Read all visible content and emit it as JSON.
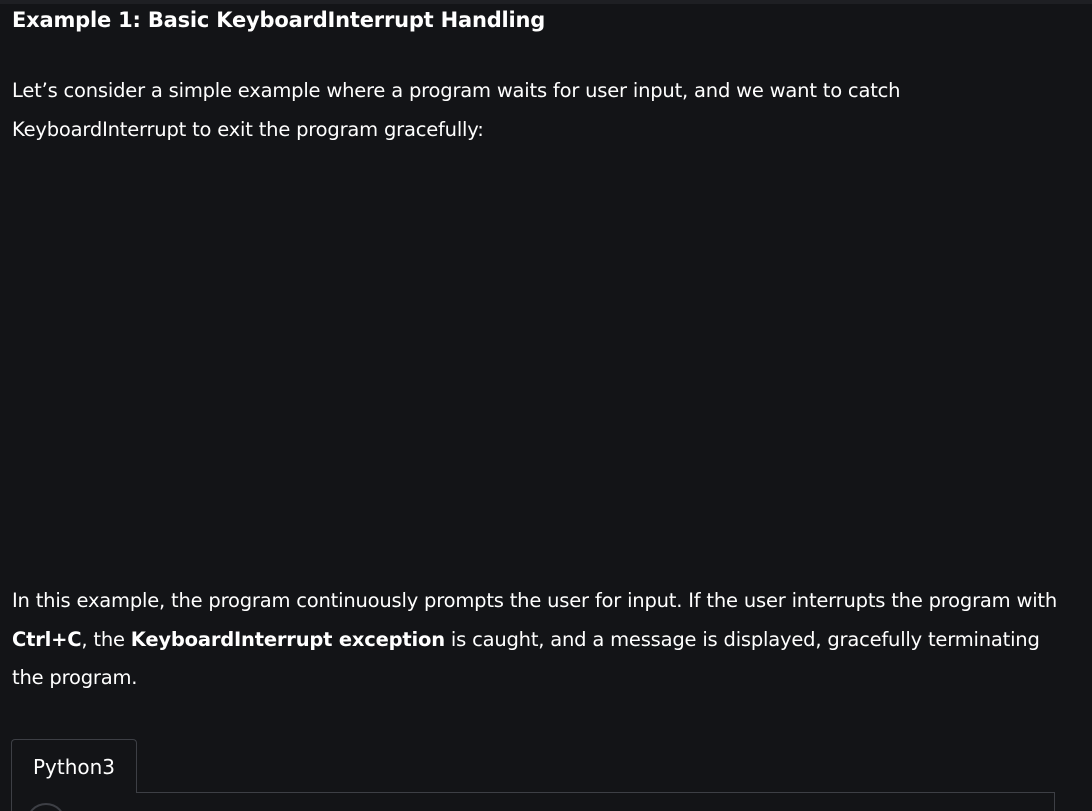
{
  "article": {
    "heading": "Example 1: Basic KeyboardInterrupt Handling",
    "intro": {
      "text": "Let’s consider a simple example where a program waits for user input, and we want to catch KeyboardInterrupt to exit the program gracefully:"
    },
    "explanation": {
      "part1": "In this example, the program continuously prompts the user for input. If the user interrupts the program with ",
      "key_combo": "Ctrl+C",
      "part2": ", the ",
      "exception_name": "KeyboardInterrupt exception",
      "part3": " is caught, and a message is displayed, gracefully terminating the program."
    }
  },
  "code_block": {
    "language_tab": "Python3"
  }
}
